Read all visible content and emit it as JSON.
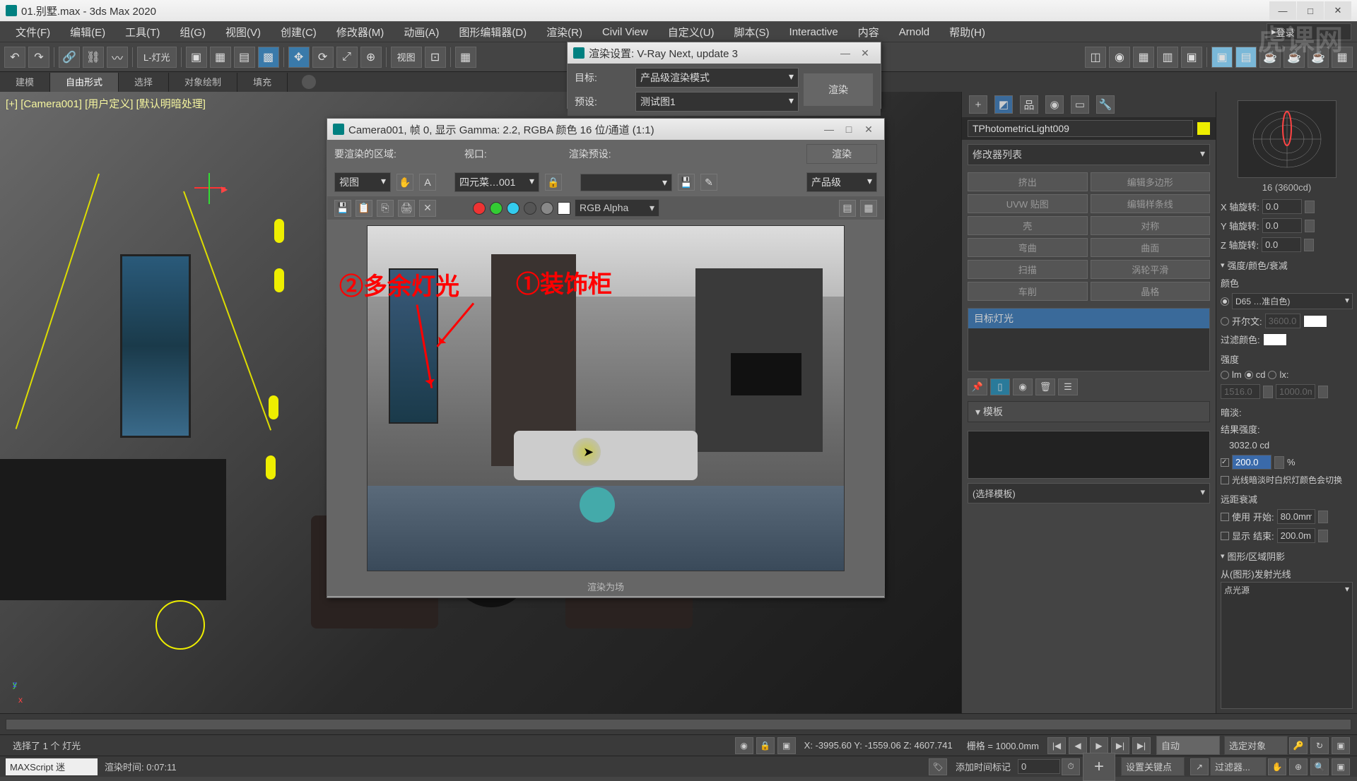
{
  "titlebar": {
    "title": "01.别墅.max - 3ds Max 2020"
  },
  "menus": [
    "文件(F)",
    "编辑(E)",
    "工具(T)",
    "组(G)",
    "视图(V)",
    "创建(C)",
    "修改器(M)",
    "动画(A)",
    "图形编辑器(D)",
    "渲染(R)",
    "Civil View",
    "自定义(U)",
    "脚本(S)",
    "Interactive",
    "内容",
    "Arnold",
    "帮助(H)"
  ],
  "login": "登录",
  "toolbar": {
    "layer": "L-灯光",
    "view": "视图"
  },
  "subtabs": {
    "a": "建模",
    "b": "自由形式",
    "c": "选择",
    "d": "对象绘制",
    "e": "填充"
  },
  "viewport_label": "[+] [Camera001] [用户定义] [默认明暗处理]",
  "render_settings": {
    "title": "渲染设置: V-Ray Next, update 3",
    "target_lbl": "目标:",
    "target_val": "产品级渲染模式",
    "preset_lbl": "预设:",
    "preset_val": "测试图1",
    "btn": "渲染"
  },
  "render_output": {
    "title": "Camera001, 帧 0, 显示 Gamma: 2.2, RGBA 颜色 16 位/通道 (1:1)",
    "area_lbl": "要渲染的区域:",
    "area_val": "视图",
    "vp_lbl": "视口:",
    "vp_val": "四元菜…001",
    "preset_lbl": "渲染预设:",
    "render_btn": "渲染",
    "prod_val": "产品级",
    "channel": "RGB Alpha",
    "ann1": "①装饰柜",
    "ann2": "②多余灯光",
    "footer": "渲染为场"
  },
  "right_panel": {
    "obj_name": "TPhotometricLight009",
    "modifier_lbl": "修改器列表",
    "mods": [
      "挤出",
      "编辑多边形",
      "UVW 贴图",
      "编辑样条线",
      "壳",
      "对称",
      "弯曲",
      "曲面",
      "扫描",
      "涡轮平滑",
      "车削",
      "晶格"
    ],
    "stack_item": "目标灯光",
    "rollout_template": "模板",
    "template_sel": "(选择模板)"
  },
  "far_right": {
    "ies_label": "16 (3600cd)",
    "rot_x_lbl": "X 轴旋转:",
    "rot_x": "0.0",
    "rot_y_lbl": "Y 轴旋转:",
    "rot_y": "0.0",
    "rot_z_lbl": "Z 轴旋转:",
    "rot_z": "0.0",
    "sect_intensity": "强度/颜色/衰减",
    "color_lbl": "颜色",
    "color_dd": "D65 …准白色)",
    "kelvin_lbl": "开尔文:",
    "kelvin": "3600.0",
    "filter_lbl": "过滤颜色:",
    "int_lbl": "强度",
    "unit_lm": "lm",
    "unit_cd": "cd",
    "unit_lx": "lx:",
    "int_val1": "1516.0",
    "int_val2": "1000.0m",
    "dim_lbl": "暗淡:",
    "result_lbl": "结果强度:",
    "result_val": "3032.0 cd",
    "pct_val": "200.0",
    "pct_unit": "%",
    "incand_lbl": "光线暗淡时白炽灯颜色会切换",
    "far_att_lbl": "远距衰减",
    "use_lbl": "使用",
    "start_lbl": "开始:",
    "start_val": "80.0mm",
    "show_lbl": "显示",
    "end_lbl": "结束:",
    "end_val": "200.0m",
    "sect_shape": "图形/区域阴影",
    "emit_lbl": "从(图形)发射光线",
    "emit_dd": "点光源"
  },
  "status": {
    "sel": "选择了 1 个 灯光",
    "coords": "X: -3995.60  Y: -1559.06  Z: 4607.741",
    "grid": "栅格 = 1000.0mm",
    "auto": "自动",
    "sel_obj": "选定对象",
    "keyfilter": "设置关键点",
    "filter": "过滤器..."
  },
  "bottom": {
    "maxscript": "MAXScript 迷",
    "render_time": "渲染时间: 0:07:11",
    "add_marker": "添加时间标记",
    "frame": "0"
  },
  "watermark": "虎课网"
}
